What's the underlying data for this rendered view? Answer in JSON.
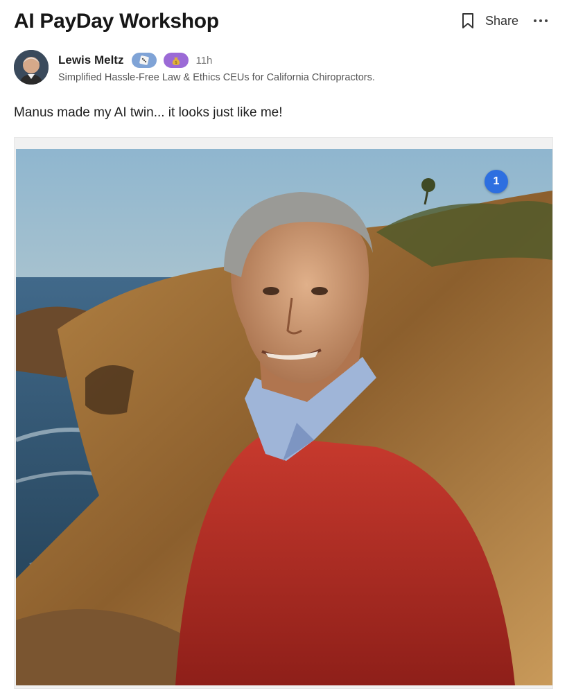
{
  "header": {
    "title": "AI PayDay Workshop",
    "share_label": "Share",
    "icons": {
      "bookmark": "bookmark-icon",
      "more": "more-horizontal-icon"
    }
  },
  "post": {
    "author": {
      "name": "Lewis Meltz",
      "bio": "Simplified Hassle-Free Law & Ethics CEUs for California Chiropractors.",
      "time": "11h",
      "badges": [
        {
          "icon": "dice-icon",
          "color": "#7fa3d6"
        },
        {
          "icon": "money-bag-icon",
          "color": "#9b6ad6"
        }
      ]
    },
    "text": "Manus made my AI twin... it looks just like me!",
    "media": {
      "image_counter": "1",
      "counter_color": "#2d6fe0"
    }
  }
}
